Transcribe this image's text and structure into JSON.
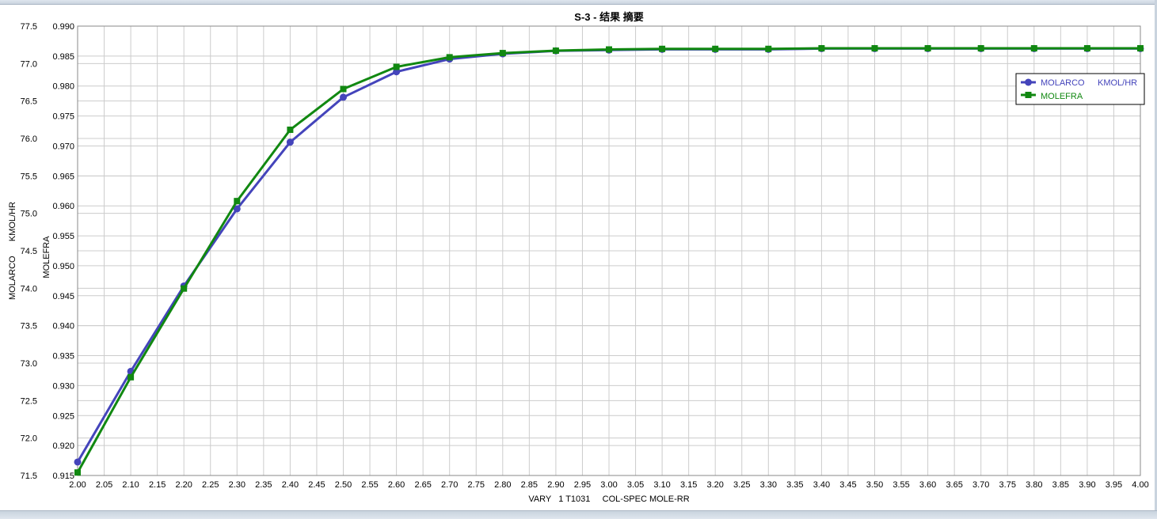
{
  "window": {
    "colors": {
      "frame": "#c9d3de",
      "grid": "#cccccc"
    }
  },
  "chart_data": {
    "type": "line",
    "title": "S-3 - 结果 摘要",
    "xlabel": "VARY   1 T1031     COL-SPEC MOLE-RR",
    "ylabel_left": "MOLARCO      KMOL/HR",
    "ylabel_right": "MOLEFRA",
    "xlim": [
      2.0,
      4.0
    ],
    "ylim_left": [
      71.5,
      77.5
    ],
    "ylim_right": [
      0.915,
      0.99
    ],
    "x_ticks": [
      "2.00",
      "2.05",
      "2.10",
      "2.15",
      "2.20",
      "2.25",
      "2.30",
      "2.35",
      "2.40",
      "2.45",
      "2.50",
      "2.55",
      "2.60",
      "2.65",
      "2.70",
      "2.75",
      "2.80",
      "2.85",
      "2.90",
      "2.95",
      "3.00",
      "3.05",
      "3.10",
      "3.15",
      "3.20",
      "3.25",
      "3.30",
      "3.35",
      "3.40",
      "3.45",
      "3.50",
      "3.55",
      "3.60",
      "3.65",
      "3.70",
      "3.75",
      "3.80",
      "3.85",
      "3.90",
      "3.95",
      "4.00"
    ],
    "y_ticks_left": [
      "77.5",
      "77.0",
      "76.5",
      "76.0",
      "75.5",
      "75.0",
      "74.5",
      "74.0",
      "73.5",
      "73.0",
      "72.5",
      "72.0",
      "71.5"
    ],
    "y_ticks_right": [
      "0.990",
      "0.985",
      "0.980",
      "0.975",
      "0.970",
      "0.965",
      "0.960",
      "0.955",
      "0.950",
      "0.945",
      "0.940",
      "0.935",
      "0.930",
      "0.925",
      "0.920",
      "0.915"
    ],
    "grid": true,
    "legend_position": "top-right",
    "legend": {
      "series1_name": "MOLARCO",
      "series1_unit": "KMOL/HR",
      "series2_name": "MOLEFRA"
    },
    "x": [
      2.0,
      2.1,
      2.2,
      2.3,
      2.4,
      2.5,
      2.6,
      2.7,
      2.8,
      2.9,
      3.0,
      3.1,
      3.2,
      3.3,
      3.4,
      3.5,
      3.6,
      3.7,
      3.8,
      3.9,
      4.0
    ],
    "series": [
      {
        "name": "MOLARCO",
        "axis": "left",
        "color": "#4444bb",
        "marker": "circle",
        "values": [
          71.68,
          72.89,
          74.03,
          75.06,
          75.95,
          76.55,
          76.89,
          77.06,
          77.13,
          77.17,
          77.18,
          77.19,
          77.19,
          77.19,
          77.2,
          77.2,
          77.2,
          77.2,
          77.2,
          77.2,
          77.2
        ]
      },
      {
        "name": "MOLEFRA",
        "axis": "right",
        "color": "#118811",
        "marker": "square",
        "values": [
          0.9155,
          0.9314,
          0.9462,
          0.9608,
          0.9727,
          0.9795,
          0.9832,
          0.9848,
          0.9855,
          0.9859,
          0.9861,
          0.9862,
          0.9862,
          0.9862,
          0.9863,
          0.9863,
          0.9863,
          0.9863,
          0.9863,
          0.9863,
          0.9863
        ]
      }
    ]
  }
}
